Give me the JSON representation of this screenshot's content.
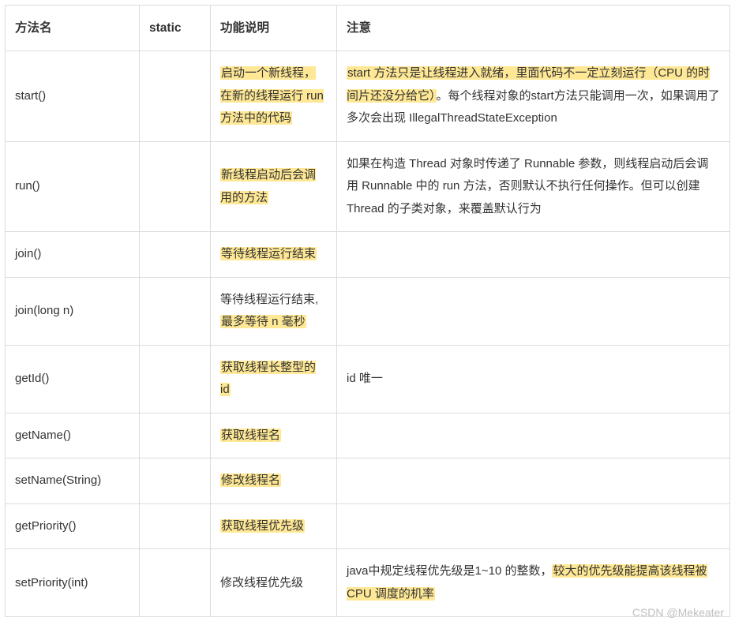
{
  "headers": {
    "method": "方法名",
    "static": "static",
    "desc": "功能说明",
    "note": "注意"
  },
  "rows": [
    {
      "method": "start()",
      "static_": "",
      "desc_segments": [
        {
          "t": "启动一个新线程，在新的线程运行 run 方法中的代码",
          "hl": true
        }
      ],
      "note_segments": [
        {
          "t": "start 方法只是让线程进入就绪，里面代码不一定立刻运行（CPU 的时间片还没分给它）",
          "hl": true
        },
        {
          "t": "。每个线程对象的start方法只能调用一次，如果调用了多次会出现 IllegalThreadStateException",
          "hl": false
        }
      ]
    },
    {
      "method": "run()",
      "static_": "",
      "desc_segments": [
        {
          "t": "新线程启动后会调用的方法",
          "hl": true
        }
      ],
      "note_segments": [
        {
          "t": "如果在构造 Thread 对象时传递了 Runnable 参数，则线程启动后会调用 Runnable 中的 run 方法，否则默认不执行任何操作。但可以创建 Thread 的子类对象，来覆盖默认行为",
          "hl": false
        }
      ]
    },
    {
      "method": "join()",
      "static_": "",
      "desc_segments": [
        {
          "t": "等待线程运行结束",
          "hl": true
        }
      ],
      "note_segments": []
    },
    {
      "method": "join(long n)",
      "static_": "",
      "desc_segments": [
        {
          "t": "等待线程运行结束,",
          "hl": false
        },
        {
          "t": "最多等待 n 毫秒",
          "hl": true
        }
      ],
      "note_segments": []
    },
    {
      "method": "getId()",
      "static_": "",
      "desc_segments": [
        {
          "t": "获取线程长整型的 id",
          "hl": true
        }
      ],
      "note_segments": [
        {
          "t": "id 唯一",
          "hl": false
        }
      ]
    },
    {
      "method": "getName()",
      "static_": "",
      "desc_segments": [
        {
          "t": "获取线程名",
          "hl": true
        }
      ],
      "note_segments": []
    },
    {
      "method": "setName(String)",
      "static_": "",
      "desc_segments": [
        {
          "t": "修改线程名",
          "hl": true
        }
      ],
      "note_segments": []
    },
    {
      "method": "getPriority()",
      "static_": "",
      "desc_segments": [
        {
          "t": "获取线程优先级",
          "hl": true
        }
      ],
      "note_segments": []
    },
    {
      "method": "setPriority(int)",
      "static_": "",
      "desc_segments": [
        {
          "t": "修改线程优先级",
          "hl": false
        }
      ],
      "note_segments": [
        {
          "t": "java中规定线程优先级是1~10 的整数，",
          "hl": false
        },
        {
          "t": "较大的优先级能提高该线程被 CPU 调度的机率",
          "hl": true
        }
      ]
    }
  ],
  "watermark": "CSDN @Mekeater"
}
